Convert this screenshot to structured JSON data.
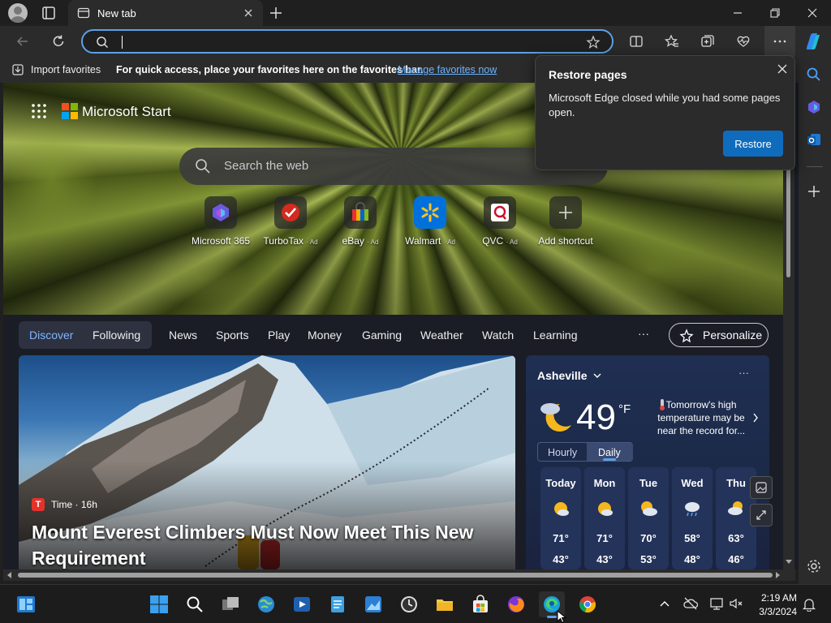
{
  "browser": {
    "tab_title": "New tab",
    "address_value": "",
    "favorites_bar": {
      "import_label": "Import favorites",
      "hint": "For quick access, place your favorites here on the favorites bar.",
      "manage_link": "Manage favorites now"
    }
  },
  "new_tab": {
    "brand": "Microsoft Start",
    "search_placeholder": "Search the web",
    "shortcuts": [
      {
        "label": "Microsoft 365",
        "ad": "",
        "icon": "microsoft365-icon"
      },
      {
        "label": "TurboTax",
        "ad": "· Ad",
        "icon": "turbotax-icon"
      },
      {
        "label": "eBay",
        "ad": "· Ad",
        "icon": "ebay-icon"
      },
      {
        "label": "Walmart",
        "ad": "· Ad",
        "icon": "walmart-icon"
      },
      {
        "label": "QVC",
        "ad": "· Ad",
        "icon": "qvc-icon"
      },
      {
        "label": "Add shortcut",
        "ad": "",
        "icon": "plus-icon"
      }
    ],
    "nav": {
      "tabs": [
        "Discover",
        "Following",
        "News",
        "Sports",
        "Play",
        "Money",
        "Gaming",
        "Weather",
        "Watch",
        "Learning"
      ],
      "more": "···",
      "personalize": "Personalize"
    },
    "news": {
      "source_logo": "T",
      "source": "Time · 16h",
      "title": "Mount Everest Climbers Must Now Meet This New Requirement"
    },
    "weather": {
      "city": "Asheville",
      "temp": "49",
      "unit": "°F",
      "note": "Tomorrow's high temperature may be near the record for...",
      "toggle": [
        "Hourly",
        "Daily"
      ],
      "more": "···",
      "days": [
        {
          "name": "Today",
          "high": "71°",
          "low": "43°",
          "icon": "sunny-icon"
        },
        {
          "name": "Mon",
          "high": "71°",
          "low": "43°",
          "icon": "sunny-icon"
        },
        {
          "name": "Tue",
          "high": "70°",
          "low": "53°",
          "icon": "partly-cloudy-icon"
        },
        {
          "name": "Wed",
          "high": "58°",
          "low": "48°",
          "icon": "rain-icon"
        },
        {
          "name": "Thu",
          "high": "63°",
          "low": "46°",
          "icon": "partly-cloudy-icon"
        }
      ]
    }
  },
  "popup": {
    "title": "Restore pages",
    "message": "Microsoft Edge closed while you had some pages open.",
    "button": "Restore"
  },
  "taskbar": {
    "time": "2:19 AM",
    "date": "3/3/2024"
  },
  "colors": {
    "accent": "#0f6cbd",
    "link": "#6cb4ff",
    "focus_ring": "#5ea0e6"
  }
}
